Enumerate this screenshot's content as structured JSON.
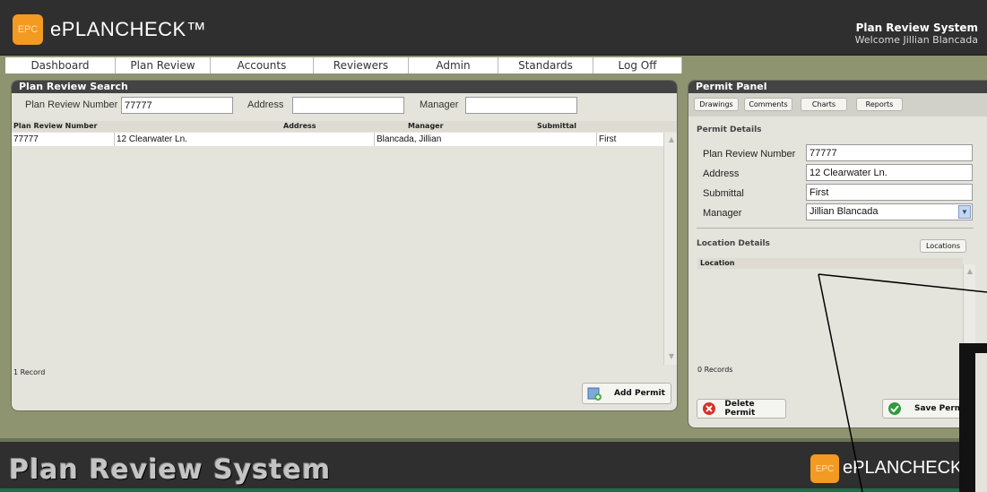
{
  "header": {
    "logo_mark": "EPC",
    "logo_text": "ePLANCHECK™",
    "system_title": "Plan Review System",
    "welcome": "Welcome Jillian Blancada"
  },
  "nav": {
    "items": [
      "Dashboard",
      "Plan Review",
      "Accounts",
      "Reviewers",
      "Admin",
      "Standards",
      "Log Off"
    ]
  },
  "search": {
    "title": "Plan Review Search",
    "plan_review_number_label": "Plan Review Number",
    "plan_review_number_value": "77777",
    "address_label": "Address",
    "address_value": "",
    "manager_label": "Manager",
    "manager_value": "",
    "columns": [
      "Plan Review Number",
      "Address",
      "Manager",
      "Submittal"
    ],
    "rows": [
      {
        "number": "77777",
        "address": "12 Clearwater Ln.",
        "manager": "Blancada, Jillian",
        "submittal": "First"
      }
    ],
    "record_count": "1 Record",
    "add_permit_label": "Add Permit"
  },
  "permit_panel": {
    "title": "Permit Panel",
    "tabs": [
      "Drawings",
      "Comments",
      "Charts",
      "Reports"
    ],
    "details_title": "Permit Details",
    "fields": {
      "plan_review_number_label": "Plan Review Number",
      "plan_review_number_value": "77777",
      "address_label": "Address",
      "address_value": "12 Clearwater Ln.",
      "submittal_label": "Submittal",
      "submittal_value": "First",
      "manager_label": "Manager",
      "manager_value": "Jillian Blancada"
    },
    "location_title": "Location Details",
    "locations_button": "Locations",
    "location_column": "Location",
    "records": "0 Records",
    "delete_label": "Delete Permit",
    "save_label": "Save Permit"
  },
  "footer": {
    "title": "Plan Review System",
    "logo_mark": "EPC",
    "logo_text": "ePLANCHECK"
  },
  "colors": {
    "background": "#8e9470",
    "header": "#2f2f2f",
    "accent_orange": "#f39a22",
    "panel": "#e4e3dc",
    "delete_red": "#d8302a",
    "save_green": "#2f9a3e"
  }
}
